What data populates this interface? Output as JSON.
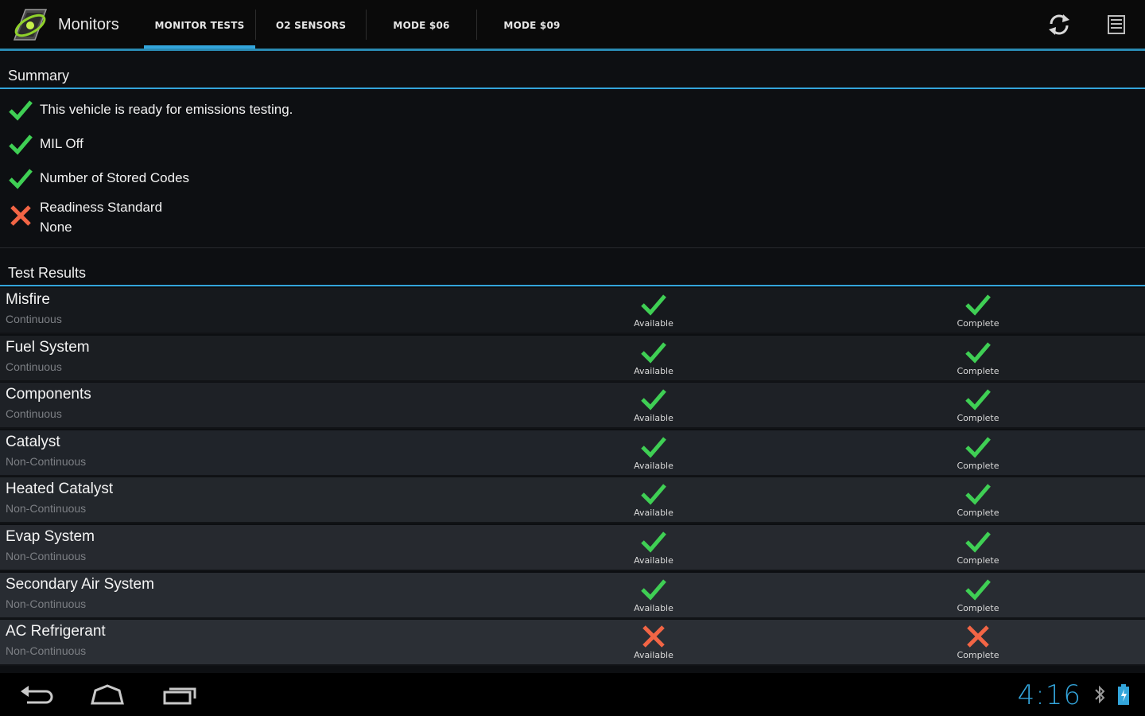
{
  "app": {
    "title": "Monitors"
  },
  "tabs": [
    {
      "label": "MONITOR TESTS",
      "active": true
    },
    {
      "label": "O2 SENSORS",
      "active": false
    },
    {
      "label": "MODE $06",
      "active": false
    },
    {
      "label": "MODE $09",
      "active": false
    }
  ],
  "actions": {
    "refresh_icon": "refresh-icon",
    "menu_icon": "overflow-menu-icon"
  },
  "summary": {
    "header": "Summary",
    "items": [
      {
        "status": "ok",
        "text": "This vehicle is ready for emissions testing.",
        "sub": ""
      },
      {
        "status": "ok",
        "text": "MIL Off",
        "sub": ""
      },
      {
        "status": "ok",
        "text": "Number of Stored Codes",
        "sub": ""
      },
      {
        "status": "fail",
        "text": "Readiness Standard",
        "sub": "None"
      }
    ]
  },
  "results": {
    "header": "Test Results",
    "rows": [
      {
        "name": "Misfire",
        "type": "Continuous",
        "available": {
          "label": "Available",
          "status": "ok"
        },
        "complete": {
          "label": "Complete",
          "status": "ok"
        }
      },
      {
        "name": "Fuel System",
        "type": "Continuous",
        "available": {
          "label": "Available",
          "status": "ok"
        },
        "complete": {
          "label": "Complete",
          "status": "ok"
        }
      },
      {
        "name": "Components",
        "type": "Continuous",
        "available": {
          "label": "Available",
          "status": "ok"
        },
        "complete": {
          "label": "Complete",
          "status": "ok"
        }
      },
      {
        "name": "Catalyst",
        "type": "Non-Continuous",
        "available": {
          "label": "Available",
          "status": "ok"
        },
        "complete": {
          "label": "Complete",
          "status": "ok"
        }
      },
      {
        "name": "Heated Catalyst",
        "type": "Non-Continuous",
        "available": {
          "label": "Available",
          "status": "ok"
        },
        "complete": {
          "label": "Complete",
          "status": "ok"
        }
      },
      {
        "name": "Evap System",
        "type": "Non-Continuous",
        "available": {
          "label": "Available",
          "status": "ok"
        },
        "complete": {
          "label": "Complete",
          "status": "ok"
        }
      },
      {
        "name": "Secondary Air System",
        "type": "Non-Continuous",
        "available": {
          "label": "Available",
          "status": "ok"
        },
        "complete": {
          "label": "Complete",
          "status": "ok"
        }
      },
      {
        "name": "AC Refrigerant",
        "type": "Non-Continuous",
        "available": {
          "label": "Available",
          "status": "fail"
        },
        "complete": {
          "label": "Complete",
          "status": "fail"
        }
      }
    ]
  },
  "navbar": {
    "back_icon": "back-icon",
    "home_icon": "home-icon",
    "recents_icon": "recent-apps-icon",
    "clock": "4:16",
    "bluetooth_icon": "bluetooth-icon",
    "battery_icon": "battery-icon"
  },
  "colors": {
    "accent": "#33a5db",
    "ok": "#3fcf54",
    "fail": "#f26545",
    "background": "#0d0f12"
  }
}
